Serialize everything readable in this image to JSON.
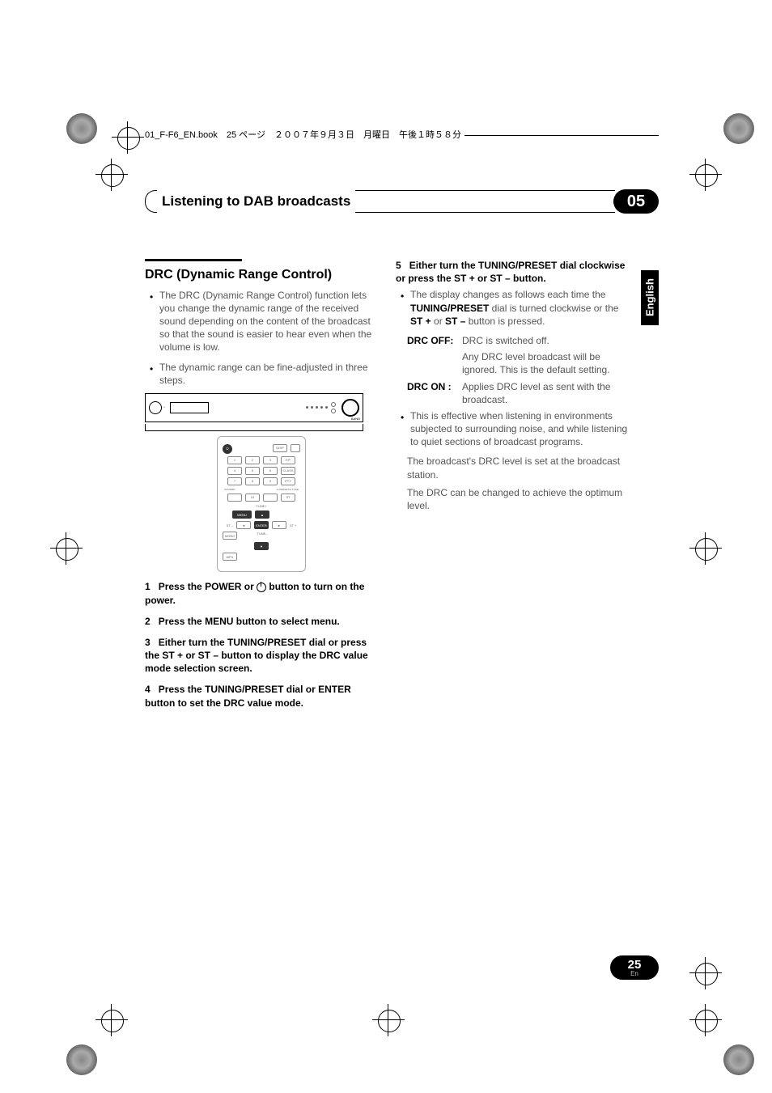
{
  "header_text": "01_F-F6_EN.book　25 ページ　２００７年９月３日　月曜日　午後１時５８分",
  "chapter": {
    "title": "Listening to DAB broadcasts",
    "number": "05"
  },
  "lang_tab": "English",
  "page": {
    "num": "25",
    "lang": "En"
  },
  "left": {
    "h2": "DRC (Dynamic Range Control)",
    "bullets": [
      "The DRC (Dynamic Range Control) function lets you change the dynamic range of the received sound depending on the content of the broadcast so that the sound is easier to hear even when the volume is low.",
      "The dynamic range can be fine-adjusted in three steps."
    ],
    "steps": [
      {
        "num": "1",
        "title_pre": "Press the POWER or ",
        "title_post": " button to turn on the power."
      },
      {
        "num": "2",
        "title": "Press the MENU button to select menu."
      },
      {
        "num": "3",
        "title": "Either turn the TUNING/PRESET dial or press the ST + or ST – button to display the DRC value mode selection screen."
      },
      {
        "num": "4",
        "title": "Press the TUNING/PRESET dial or ENTER button to set the DRC value mode."
      }
    ]
  },
  "right": {
    "step5": {
      "num": "5",
      "title": "Either turn the TUNING/PRESET dial clockwise or press the ST + or ST – button.",
      "bullet_pre": "The display changes as follows each time the ",
      "bullet_b1": "TUNING/PRESET",
      "bullet_mid": " dial is turned clockwise or the ",
      "bullet_b2": "ST +",
      "bullet_mid2": " or ",
      "bullet_b3": "ST –",
      "bullet_post": " button is pressed."
    },
    "drc_off": {
      "label": "DRC OFF:",
      "line1": "DRC is switched off.",
      "line2": "Any DRC level broadcast will be ignored. This is the default setting."
    },
    "drc_on": {
      "label": "DRC ON :",
      "line1": "Applies DRC level as sent with the broadcast."
    },
    "bullet2": "This is effective when listening in environments subjected to surrounding noise, and while listening to quiet sections of broadcast programs.",
    "para1": "The broadcast's DRC level is set at the broadcast station.",
    "para2": "The DRC can be changed to achieve the optimum level."
  },
  "remote_labels": {
    "r1": [
      "",
      "DISP",
      ""
    ],
    "r2": [
      "1",
      "2",
      "3",
      "F/P"
    ],
    "r3": [
      "4",
      "5",
      "6",
      "CLASS"
    ],
    "r4": [
      "7",
      "8",
      "9",
      "PTY"
    ],
    "r5": [
      "STANDBY",
      "D.PRESET/A.TUNE"
    ],
    "r6": [
      "",
      "10",
      "",
      "ST"
    ],
    "tune_plus": "TUNE+",
    "menu": "MENU",
    "st_minus": "ST –",
    "st_plus": "ST +",
    "enter": "ENTER",
    "tune_minus": "TUNE–",
    "mono": "MONO",
    "mpx": "MPX"
  },
  "device_label": "BAND"
}
